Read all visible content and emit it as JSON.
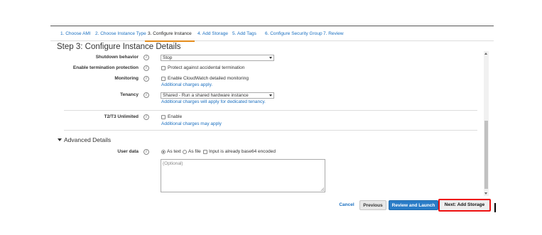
{
  "steps": [
    {
      "label": "1. Choose AMI",
      "active": false
    },
    {
      "label": "2. Choose Instance Type",
      "active": false
    },
    {
      "label": "3. Configure Instance",
      "active": true
    },
    {
      "label": "4. Add Storage",
      "active": false
    },
    {
      "label": "5. Add Tags",
      "active": false
    },
    {
      "label": "6. Configure Security Group",
      "active": false
    },
    {
      "label": "7. Review",
      "active": false
    }
  ],
  "page_title": "Step 3: Configure Instance Details",
  "form": {
    "shutdown": {
      "label": "Shutdown behavior",
      "value": "Stop"
    },
    "termination": {
      "label": "Enable termination protection",
      "option": "Protect against accidental termination"
    },
    "monitoring": {
      "label": "Monitoring",
      "option": "Enable CloudWatch detailed monitoring",
      "note": "Additional charges apply."
    },
    "tenancy": {
      "label": "Tenancy",
      "value": "Shared - Run a shared hardware instance",
      "note": "Additional charges will apply for dedicated tenancy."
    },
    "t2t3": {
      "label": "T2/T3 Unlimited",
      "option": "Enable",
      "note": "Additional charges may apply"
    }
  },
  "advanced": {
    "heading": "Advanced Details",
    "user_data": {
      "label": "User data",
      "option_text": "As text",
      "option_file": "As file",
      "option_base64": "Input is already base64 encoded",
      "placeholder": "(Optional)"
    }
  },
  "buttons": {
    "cancel": "Cancel",
    "previous": "Previous",
    "review": "Review and Launch",
    "next": "Next: Add Storage"
  },
  "colors": {
    "link": "#1a6fc0",
    "active_tab_underline": "#e48c1c",
    "primary_button": "#2a7cc7",
    "highlight_box": "#ee1111"
  }
}
